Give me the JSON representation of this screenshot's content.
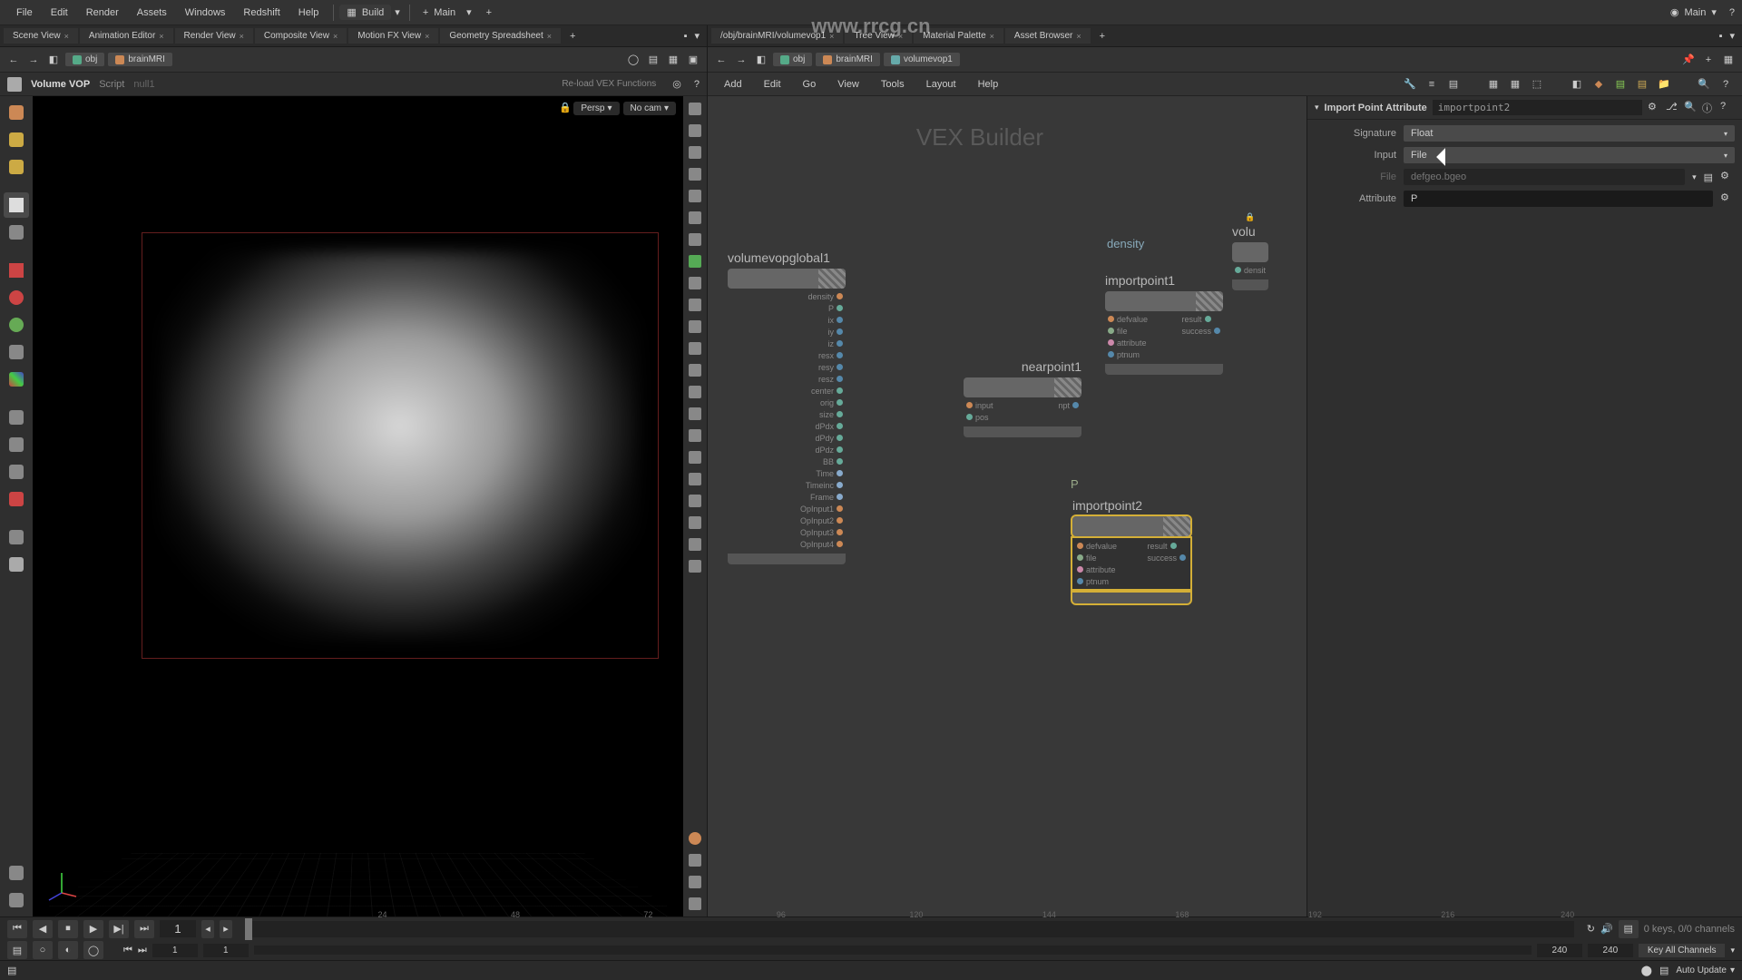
{
  "menu": {
    "file": "File",
    "edit": "Edit",
    "render": "Render",
    "assets": "Assets",
    "windows": "Windows",
    "redshift": "Redshift",
    "help": "Help"
  },
  "desktop": "Build",
  "main_shelf": "Main",
  "top_right_main": "Main",
  "left_pane_tabs": [
    "Scene View",
    "Animation Editor",
    "Render View",
    "Composite View",
    "Motion FX View",
    "Geometry Spreadsheet"
  ],
  "right_pane_tabs": [
    "/obj/brainMRI/volumevop1",
    "Tree View",
    "Material Palette",
    "Asset Browser"
  ],
  "left_path": {
    "obj": "obj",
    "brain": "brainMRI"
  },
  "right_path": {
    "obj": "obj",
    "brain": "brainMRI",
    "vop": "volumevop1"
  },
  "viewport_header": {
    "vop": "Volume VOP",
    "script": "Script",
    "null": "null1",
    "reload": "Re-load VEX Functions"
  },
  "viewport_chips": {
    "persp": "Persp",
    "nocam": "No cam"
  },
  "node_menu": {
    "add": "Add",
    "edit": "Edit",
    "go": "Go",
    "view": "View",
    "tools": "Tools",
    "layout": "Layout",
    "help": "Help"
  },
  "vex_builder_label": "VEX Builder",
  "nodes": {
    "volumevopglobal": {
      "title": "volumevopglobal1",
      "outputs": [
        "P",
        "ix",
        "iy",
        "iz",
        "resx",
        "resy",
        "resz",
        "center",
        "orig",
        "size",
        "dPdx",
        "dPdy",
        "dPdz",
        "BB",
        "Time",
        "Timeinc",
        "Frame",
        "OpInput1",
        "OpInput2",
        "OpInput3",
        "OpInput4"
      ],
      "out_density": "density"
    },
    "nearpoint1": {
      "title": "nearpoint1",
      "inputs": [
        "input",
        "pos"
      ],
      "outputs": [
        "npt"
      ]
    },
    "importpoint1": {
      "title": "importpoint1",
      "inputs": [
        "defvalue",
        "file",
        "attribute",
        "ptnum"
      ],
      "outputs": [
        "result",
        "success"
      ]
    },
    "importpoint2": {
      "title": "importpoint2",
      "inputs": [
        "defvalue",
        "file",
        "attribute",
        "ptnum"
      ],
      "outputs": [
        "result",
        "success"
      ]
    },
    "volu": {
      "title": "volu",
      "out": "densit"
    }
  },
  "tags": {
    "density": "density",
    "p": "P"
  },
  "prop_panel": {
    "title": "Import Point Attribute",
    "name": "importpoint2",
    "signature_label": "Signature",
    "signature_value": "Float",
    "input_label": "Input",
    "input_value": "File",
    "file_label": "File",
    "file_placeholder": "defgeo.bgeo",
    "attribute_label": "Attribute",
    "attribute_value": "P"
  },
  "timeline": {
    "frame": "1",
    "ticks": [
      "24",
      "48",
      "72",
      "96",
      "120",
      "144",
      "168",
      "192",
      "216",
      "240"
    ],
    "end_a": "240",
    "end_b": "240",
    "keys_info": "0 keys, 0/0 channels",
    "range_start": "1",
    "range_start2": "1",
    "key_all": "Key All Channels",
    "auto_update": "Auto Update"
  },
  "watermark_url": "www.rrcg.cn",
  "watermark_text": "RRCG"
}
